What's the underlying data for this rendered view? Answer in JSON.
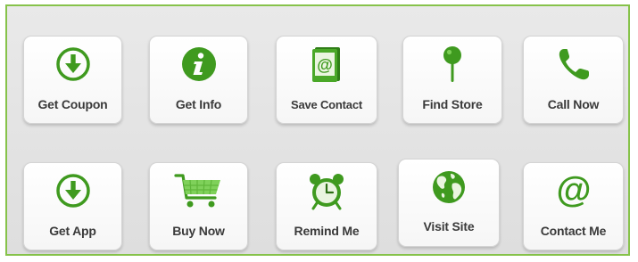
{
  "accent_color": "#3f9a1f",
  "buttons": [
    {
      "label": "Get Coupon",
      "icon": "download-circle-icon"
    },
    {
      "label": "Get Info",
      "icon": "info-icon"
    },
    {
      "label": "Save Contact",
      "icon": "address-book-icon"
    },
    {
      "label": "Find Store",
      "icon": "map-pin-icon"
    },
    {
      "label": "Call Now",
      "icon": "phone-icon"
    },
    {
      "label": "Get App",
      "icon": "download-circle-icon"
    },
    {
      "label": "Buy Now",
      "icon": "shopping-cart-icon"
    },
    {
      "label": "Remind Me",
      "icon": "alarm-clock-icon"
    },
    {
      "label": "Visit Site",
      "icon": "globe-icon"
    },
    {
      "label": "Contact Me",
      "icon": "at-sign-icon"
    }
  ]
}
